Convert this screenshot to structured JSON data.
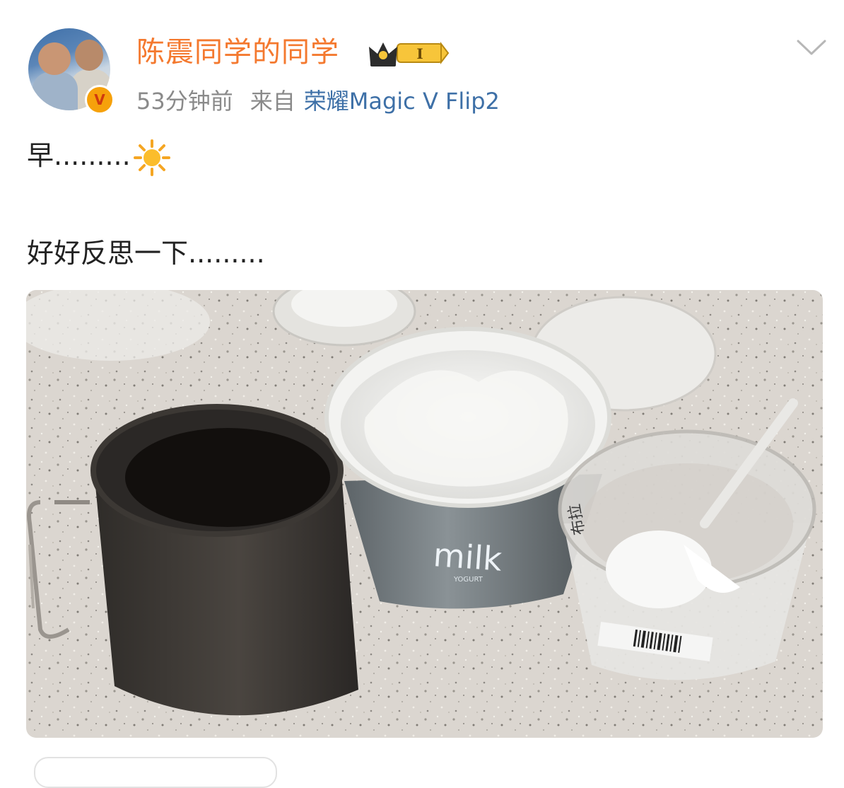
{
  "post": {
    "username": "陈震同学的同学",
    "level_badge": "I",
    "time": "53分钟前",
    "from_label": "来自",
    "device": "荣耀Magic V Flip2",
    "line1": "早.........",
    "line2": "好好反思一下.........",
    "verified_mark": "V"
  },
  "photo": {
    "cup_brand_text": "milk",
    "cup_small_text": "YOGURT",
    "tub_text": "布拉",
    "scene": [
      "mug",
      "yogurt-cup",
      "pudding-tub",
      "spoon",
      "lids"
    ]
  },
  "colors": {
    "username": "#f4792f",
    "device_link": "#3e70a7",
    "meta": "#8a8a8a",
    "body_text": "#222222",
    "counter": "#d9d4cd"
  },
  "icons": [
    "crown-icon",
    "chevron-down-icon",
    "sun-emoji-icon",
    "verified-icon"
  ]
}
